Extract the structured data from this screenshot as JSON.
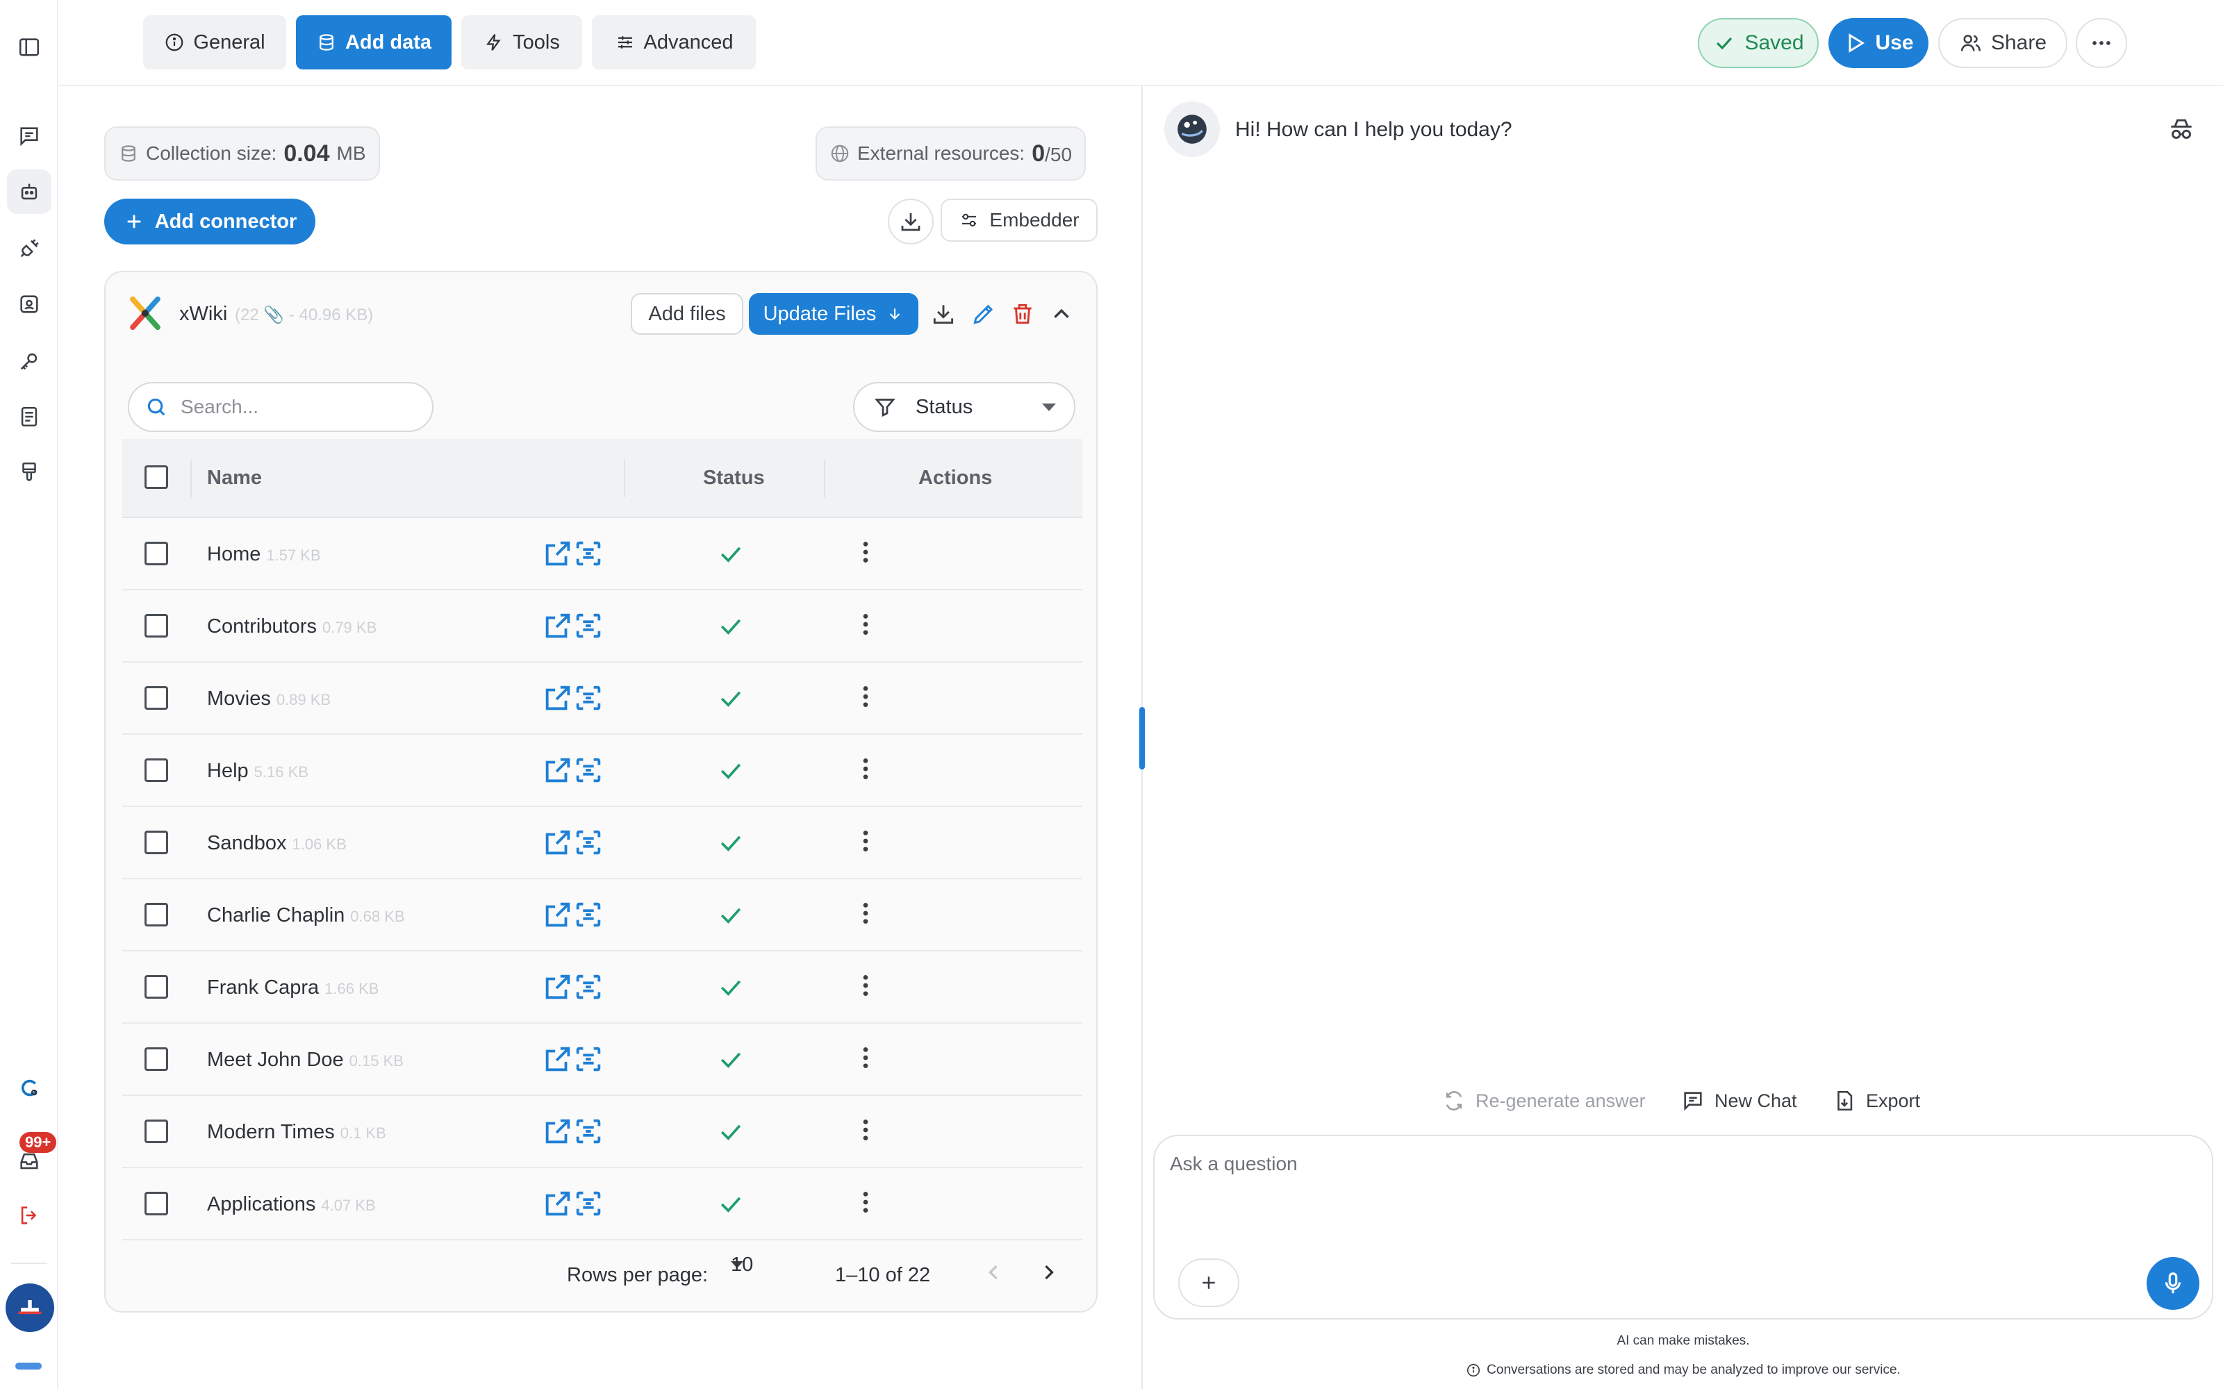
{
  "tabs": [
    {
      "label": "General",
      "icon": "info-circle-icon"
    },
    {
      "label": "Add data",
      "icon": "database-icon",
      "active": true
    },
    {
      "label": "Tools",
      "icon": "bolt-icon"
    },
    {
      "label": "Advanced",
      "icon": "sliders-icon"
    }
  ],
  "header_actions": {
    "saved_label": "Saved",
    "use_label": "Use",
    "share_label": "Share"
  },
  "collection": {
    "size_label": "Collection size:",
    "size_value": "0.04",
    "size_unit": "MB",
    "external_label": "External resources:",
    "external_used": "0",
    "external_total": "/50"
  },
  "toolbar": {
    "add_connector": "Add connector",
    "embedder": "Embedder"
  },
  "source": {
    "name": "xWiki",
    "meta": "(22 📎 - 40.96 KB)",
    "add_files": "Add files",
    "update_files": "Update Files"
  },
  "filters": {
    "search_placeholder": "Search...",
    "status_label": "Status"
  },
  "table": {
    "columns": [
      "Name",
      "Status",
      "Actions"
    ],
    "rows": [
      {
        "name": "Home",
        "size": "1.57 KB"
      },
      {
        "name": "Contributors",
        "size": "0.79 KB"
      },
      {
        "name": "Movies",
        "size": "0.89 KB"
      },
      {
        "name": "Help",
        "size": "5.16 KB"
      },
      {
        "name": "Sandbox",
        "size": "1.06 KB"
      },
      {
        "name": "Charlie Chaplin",
        "size": "0.68 KB"
      },
      {
        "name": "Frank Capra",
        "size": "1.66 KB"
      },
      {
        "name": "Meet John Doe",
        "size": "0.15 KB"
      },
      {
        "name": "Modern Times",
        "size": "0.1 KB"
      },
      {
        "name": "Applications",
        "size": "4.07 KB"
      }
    ]
  },
  "pagination": {
    "rows_per_page_label": "Rows per page:",
    "rows_per_page_value": "10",
    "range": "1–10 of 22"
  },
  "chat": {
    "greeting": "Hi! How can I help you today?",
    "regenerate": "Re-generate answer",
    "new_chat": "New Chat",
    "export": "Export",
    "input_placeholder": "Ask a question",
    "disclaimer": "AI can make mistakes.",
    "privacy": "Conversations are stored and may be analyzed to improve our service."
  },
  "notifications": {
    "badge": "99+"
  },
  "colors": {
    "accent": "#1e7fd6",
    "success": "#1e9e6a",
    "danger": "#d9342b"
  }
}
